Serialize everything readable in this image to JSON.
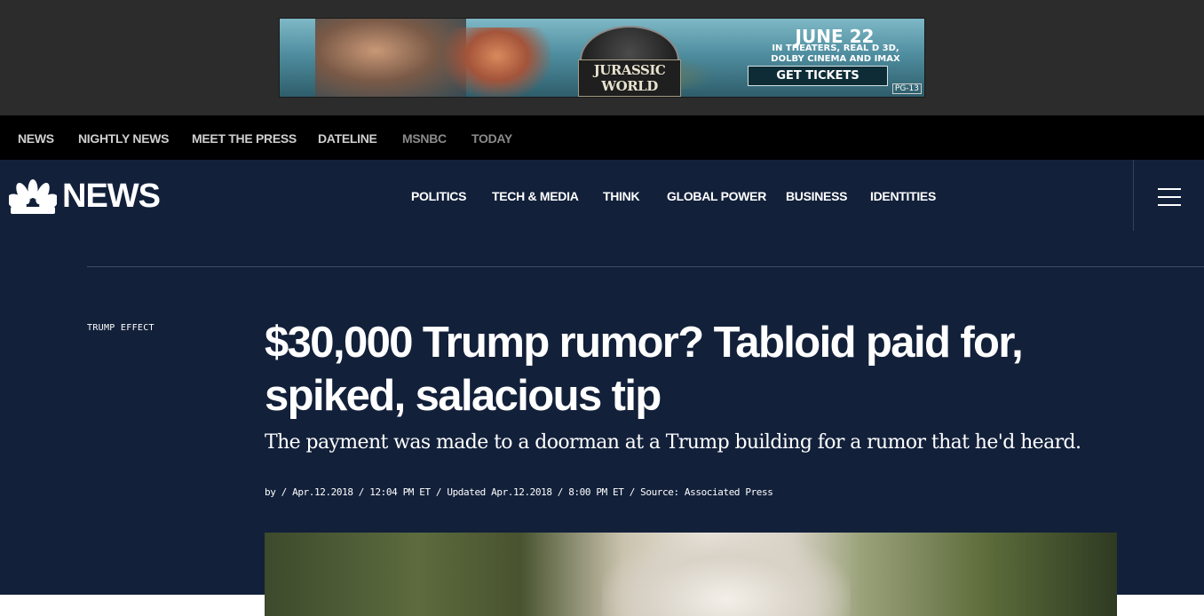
{
  "ad": {
    "brand": "JURASSIC WORLD",
    "date": "JUNE 22",
    "subline1": "IN THEATERS, REAL D 3D,",
    "subline2": "DOLBY CINEMA AND IMAX",
    "cta": "GET TICKETS",
    "rating": "PG-13"
  },
  "network_nav": [
    "NEWS",
    "NIGHTLY NEWS",
    "MEET THE PRESS",
    "DATELINE",
    "MSNBC",
    "TODAY"
  ],
  "header": {
    "logo_text": "NEWS",
    "nav": [
      "POLITICS",
      "TECH & MEDIA",
      "THINK",
      "GLOBAL POWER",
      "BUSINESS",
      "IDENTITIES"
    ]
  },
  "article": {
    "section": "TRUMP EFFECT",
    "headline": "$30,000 Trump rumor? Tabloid paid for, spiked, salacious tip",
    "dek": "The payment was made to a doorman at a Trump building for a rumor that he'd heard.",
    "byline": "by / Apr.12.2018 / 12:04 PM ET / Updated Apr.12.2018 / 8:00 PM ET / Source: Associated Press"
  },
  "colors": {
    "header_bg": "#12203a",
    "network_bg": "#000000",
    "ad_bg": "#2c2c2c"
  }
}
